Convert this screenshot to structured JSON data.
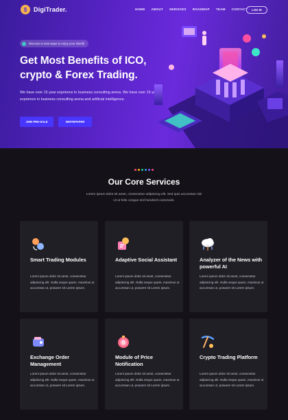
{
  "brand": {
    "name": "DigiTrader.",
    "logo_letter": "$"
  },
  "nav": {
    "items": [
      "HOME",
      "ABOUT",
      "SERVICES",
      "ROADMAP",
      "TEAM",
      "CONTACT"
    ],
    "login": "LOG IN"
  },
  "hero": {
    "pill": "Discover a new ways to enjoy your World!",
    "title": "Get Most Benefits of ICO, crypto & Forex Trading.",
    "description": "We have over 15 year exprience in business consulting arena. We have over 15 year exprience in business consulting arena and artificial intelligence.",
    "buttons": {
      "presale": "JOIN PRE-SALE",
      "whitepaper": "WHITEPAPER"
    }
  },
  "services": {
    "dot_colors": [
      "#ff4d6d",
      "#ffb020",
      "#20c997",
      "#339af0",
      "#845ef7",
      "#e64980"
    ],
    "title": "Our Core Services",
    "description": "Lorem ipsum dolor sit amet, consectetur adipiscing elit. Sed quis accumsan nisi Ut ut felis congue nisl hendrerit commodo.",
    "cards": [
      {
        "icon": "trading-modules-icon",
        "title": "Smart Trading Modules",
        "text": "Lorem ipsum dolor sit amet, consectetur adipiscing elit. Nulla neque quam, maximus ut accumsan ut, posuere sit Lorem ipsum."
      },
      {
        "icon": "social-assistant-icon",
        "title": "Adaptive Social Assistant",
        "text": "Lorem ipsum dolor sit amet, consectetur adipiscing elit. Nulla neque quam, maximus ut accumsan ut, posuere sit Lorem ipsum."
      },
      {
        "icon": "cloud-network-icon",
        "title": "Analyzer of the News with powerful AI",
        "text": "Lorem ipsum dolor sit amet, consectetur adipiscing elit. Nulla neque quam, maximus ut accumsan ut, posuere sit Lorem ipsum."
      },
      {
        "icon": "wallet-icon",
        "title": "Exchange Order Management",
        "text": "Lorem ipsum dolor sit amet, consectetur adipiscing elit. Nulla neque quam, maximus ut accumsan ut, posuere sit Lorem ipsum."
      },
      {
        "icon": "price-notification-icon",
        "title": "Module of Price Notification",
        "text": "Lorem ipsum dolor sit amet, consectetur adipiscing elit. Nulla neque quam, maximus ut accumsan ut, posuere sit Lorem ipsum."
      },
      {
        "icon": "pickaxe-mining-icon",
        "title": "Crypto Trading Platform",
        "text": "Lorem ipsum dolor sit amet, consectetur adipiscing elit. Nulla neque quam, maximus ut accumsan ut, posuere sit Lorem ipsum."
      }
    ]
  },
  "colors": {
    "hero_start": "#3a1c9c",
    "hero_end": "#6a2bdc",
    "button": "#4836ff",
    "card_bg": "#201f25",
    "page_bg": "#141218"
  }
}
